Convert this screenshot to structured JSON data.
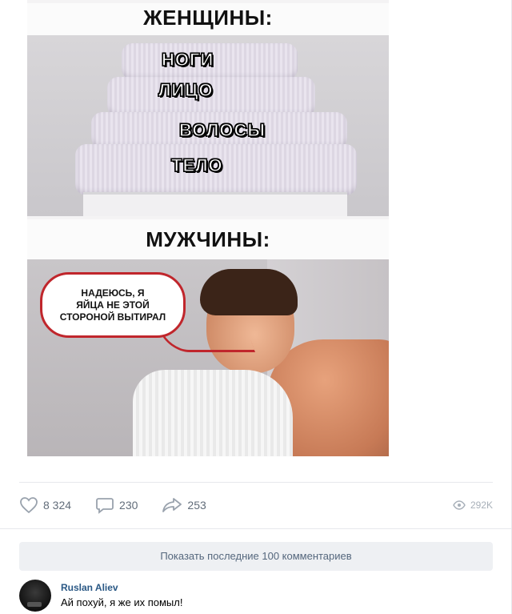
{
  "meme": {
    "women_caption": "ЖЕНЩИНЫ:",
    "towel_labels": [
      "НОГИ",
      "ЛИЦО",
      "ВОЛОСЫ",
      "ТЕЛО"
    ],
    "men_caption": "МУЖЧИНЫ:",
    "speech_bubble_lines": [
      "НАДЕЮСЬ, Я",
      "ЯЙЦА НЕ ЭТОЙ",
      "СТОРОНОЙ ВЫТИРАЛ"
    ]
  },
  "actions": {
    "likes": "8 324",
    "comments": "230",
    "shares": "253",
    "views": "292K"
  },
  "icons": {
    "like": "heart-icon",
    "comment": "comment-bubble-icon",
    "share": "share-arrow-icon",
    "views": "eye-icon"
  },
  "comments_section": {
    "show_more_label": "Показать последние 100 комментариев",
    "items": [
      {
        "author": "Ruslan Aliev",
        "text": "Ай похуй, я же их помыл!"
      }
    ]
  },
  "colors": {
    "link": "#2a5885",
    "action_text": "#626d7a",
    "button_bg": "#eef0f3",
    "bubble_border": "#c0262c"
  }
}
